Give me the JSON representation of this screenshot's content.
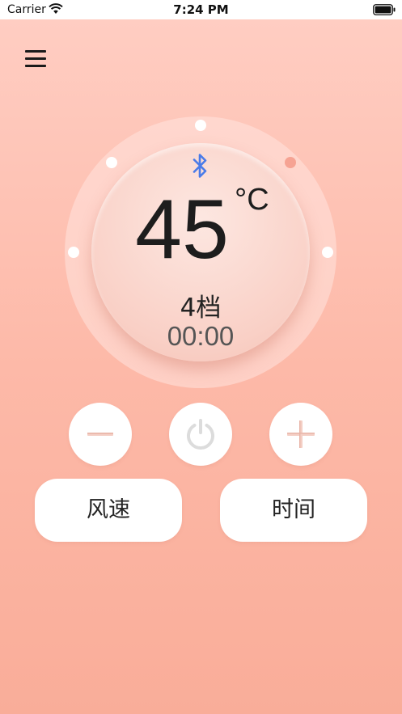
{
  "status_bar": {
    "carrier": "Carrier",
    "time": "7:24 PM"
  },
  "header": {
    "menu_icon": "hamburger-menu-icon"
  },
  "display": {
    "bluetooth_icon": "bluetooth-icon",
    "temperature": "45",
    "unit": "°C",
    "gear": "4档",
    "timer": "00:00",
    "level_dots_total": 5,
    "active_level_dot": 4
  },
  "controls": {
    "minus_icon": "minus-icon",
    "power_icon": "power-icon",
    "plus_icon": "plus-icon",
    "fan_speed_label": "风速",
    "time_label": "时间"
  },
  "colors": {
    "background_top": "#ffcdc2",
    "background_bottom": "#f9ad99",
    "active_dot": "#f6a393",
    "bluetooth": "#4a7be8"
  }
}
